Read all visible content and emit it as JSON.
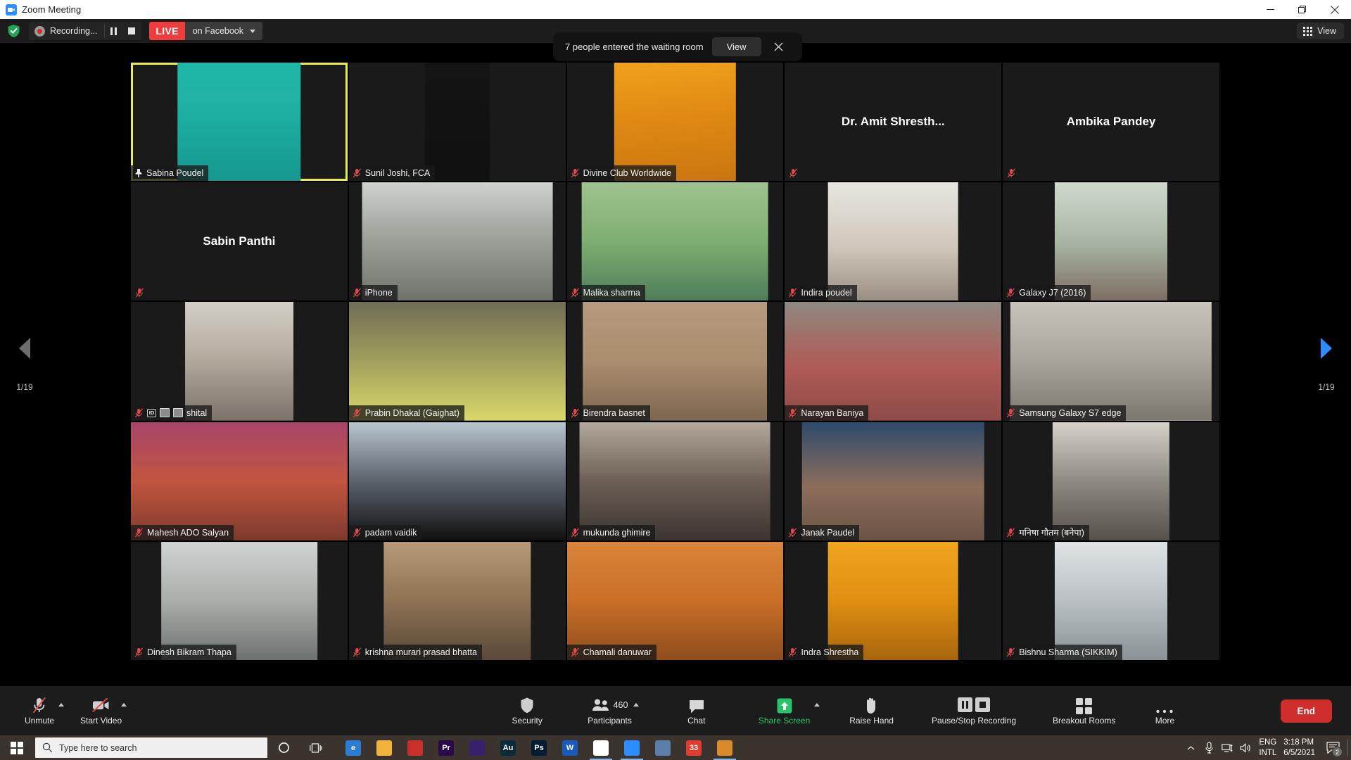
{
  "window": {
    "title": "Zoom Meeting",
    "app_icon": "zoom-camera-icon",
    "minimize_label": "Minimize",
    "maximize_label": "Maximize",
    "close_label": "Close"
  },
  "topbar": {
    "encryption_icon": "green-shield-check-icon",
    "recording_label": "Recording...",
    "pause_recording_label": "Pause recording",
    "stop_recording_label": "Stop recording",
    "live_label": "LIVE",
    "live_target": "on Facebook",
    "view_label": "View",
    "view_icon": "grid-view-icon"
  },
  "toast": {
    "message": "7 people entered the waiting room",
    "action_label": "View",
    "close_label": "Close"
  },
  "gallery": {
    "page_current": "1/19",
    "prev_label": "Previous page",
    "next_label": "Next page",
    "tiles": [
      {
        "name": "Sabina Poudel",
        "muted": false,
        "pinned": true,
        "active_speaker": true,
        "video": true,
        "label_style": "tag",
        "badges": []
      },
      {
        "name": "Sunil Joshi, FCA",
        "muted": true,
        "pinned": false,
        "active_speaker": false,
        "video": true,
        "label_style": "tag",
        "badges": []
      },
      {
        "name": "Divine Club Worldwide",
        "muted": true,
        "pinned": false,
        "active_speaker": false,
        "video": true,
        "label_style": "tag",
        "badges": []
      },
      {
        "name": "Dr. Amit Shresth...",
        "muted": true,
        "pinned": false,
        "active_speaker": false,
        "video": false,
        "label_style": "center",
        "badges": []
      },
      {
        "name": "Ambika Pandey",
        "muted": true,
        "pinned": false,
        "active_speaker": false,
        "video": false,
        "label_style": "center",
        "badges": []
      },
      {
        "name": "Sabin Panthi",
        "muted": true,
        "pinned": false,
        "active_speaker": false,
        "video": false,
        "label_style": "center",
        "badges": []
      },
      {
        "name": "iPhone",
        "muted": true,
        "pinned": false,
        "active_speaker": false,
        "video": true,
        "label_style": "tag",
        "badges": []
      },
      {
        "name": "Malika sharma",
        "muted": true,
        "pinned": false,
        "active_speaker": false,
        "video": true,
        "label_style": "tag",
        "badges": []
      },
      {
        "name": "Indira poudel",
        "muted": true,
        "pinned": false,
        "active_speaker": false,
        "video": true,
        "label_style": "tag",
        "badges": []
      },
      {
        "name": "Galaxy J7 (2016)",
        "muted": true,
        "pinned": false,
        "active_speaker": false,
        "video": true,
        "label_style": "tag",
        "badges": []
      },
      {
        "name": "shital",
        "muted": true,
        "pinned": false,
        "active_speaker": false,
        "video": true,
        "label_style": "tag",
        "badges": [
          "id-badge",
          "mini-chip",
          "mini-chip"
        ]
      },
      {
        "name": "Prabin Dhakal (Gaighat)",
        "muted": true,
        "pinned": false,
        "active_speaker": false,
        "video": true,
        "label_style": "tag",
        "badges": []
      },
      {
        "name": "Birendra basnet",
        "muted": true,
        "pinned": false,
        "active_speaker": false,
        "video": true,
        "label_style": "tag",
        "badges": []
      },
      {
        "name": "Narayan Baniya",
        "muted": true,
        "pinned": false,
        "active_speaker": false,
        "video": true,
        "label_style": "tag",
        "badges": []
      },
      {
        "name": "Samsung Galaxy S7 edge",
        "muted": true,
        "pinned": false,
        "active_speaker": false,
        "video": true,
        "label_style": "tag",
        "badges": []
      },
      {
        "name": "Mahesh ADO Salyan",
        "muted": true,
        "pinned": false,
        "active_speaker": false,
        "video": true,
        "label_style": "tag",
        "badges": []
      },
      {
        "name": "padam vaidik",
        "muted": true,
        "pinned": false,
        "active_speaker": false,
        "video": true,
        "label_style": "tag",
        "badges": []
      },
      {
        "name": "mukunda ghimire",
        "muted": true,
        "pinned": false,
        "active_speaker": false,
        "video": true,
        "label_style": "tag",
        "badges": []
      },
      {
        "name": "Janak Paudel",
        "muted": true,
        "pinned": false,
        "active_speaker": false,
        "video": true,
        "label_style": "tag",
        "badges": []
      },
      {
        "name": "मनिषा गौतम (बनेपा)",
        "muted": true,
        "pinned": false,
        "active_speaker": false,
        "video": true,
        "label_style": "tag",
        "badges": []
      },
      {
        "name": "Dinesh Bikram Thapa",
        "muted": true,
        "pinned": false,
        "active_speaker": false,
        "video": true,
        "label_style": "tag",
        "badges": []
      },
      {
        "name": "krishna murari prasad bhatta",
        "muted": true,
        "pinned": false,
        "active_speaker": false,
        "video": true,
        "label_style": "tag",
        "badges": []
      },
      {
        "name": "Chamali danuwar",
        "muted": true,
        "pinned": false,
        "active_speaker": false,
        "video": true,
        "label_style": "tag",
        "badges": []
      },
      {
        "name": "Indra Shrestha",
        "muted": true,
        "pinned": false,
        "active_speaker": false,
        "video": true,
        "label_style": "tag",
        "badges": []
      },
      {
        "name": "Bishnu Sharma (SIKKIM)",
        "muted": true,
        "pinned": false,
        "active_speaker": false,
        "video": true,
        "label_style": "tag",
        "badges": []
      }
    ]
  },
  "toolbar": {
    "unmute_label": "Unmute",
    "start_video_label": "Start Video",
    "security_label": "Security",
    "participants_label": "Participants",
    "participants_count": "460",
    "chat_label": "Chat",
    "share_screen_label": "Share Screen",
    "raise_hand_label": "Raise Hand",
    "pause_stop_recording_label": "Pause/Stop Recording",
    "breakout_rooms_label": "Breakout Rooms",
    "more_label": "More",
    "end_label": "End"
  },
  "taskbar": {
    "start_label": "Start",
    "search_placeholder": "Type here to search",
    "cortana_label": "Cortana",
    "task_view_label": "Task View",
    "apps": [
      {
        "name": "edge-icon",
        "letter": "e",
        "bg": "#2b7cd3",
        "active": false
      },
      {
        "name": "file-explorer-icon",
        "letter": "",
        "bg": "#f2b33d",
        "active": false
      },
      {
        "name": "kite-icon",
        "letter": "",
        "bg": "#c9302c",
        "active": false
      },
      {
        "name": "premiere-pro-icon",
        "letter": "Pr",
        "bg": "#2a0a4a",
        "active": false
      },
      {
        "name": "adobe-app-icon",
        "letter": "",
        "bg": "#3a1f6e",
        "active": false
      },
      {
        "name": "audition-icon",
        "letter": "Au",
        "bg": "#0b2a3a",
        "active": false
      },
      {
        "name": "photoshop-icon",
        "letter": "Ps",
        "bg": "#021c33",
        "active": false
      },
      {
        "name": "word-icon",
        "letter": "W",
        "bg": "#185abd",
        "active": false
      },
      {
        "name": "chrome-icon",
        "letter": "",
        "bg": "#ffffff",
        "active": true
      },
      {
        "name": "zoom-taskbar-icon",
        "letter": "",
        "bg": "#2d8cff",
        "active": true
      },
      {
        "name": "photos-icon",
        "letter": "",
        "bg": "#5a7fa8",
        "active": false
      },
      {
        "name": "calendar-icon",
        "letter": "33",
        "bg": "#e33b2e",
        "active": false
      },
      {
        "name": "media-player-icon",
        "letter": "",
        "bg": "#d98a2b",
        "active": true
      }
    ],
    "tray": {
      "show_hidden_label": "Show hidden icons",
      "mic_icon": "microphone-icon",
      "network_icon": "network-icon",
      "volume_icon": "speaker-icon",
      "language": "ENG",
      "language_sub": "INTL",
      "time": "3:18 PM",
      "date": "6/5/2021",
      "notification_count": "2"
    }
  },
  "colors": {
    "accent_blue": "#2d8cff",
    "live_red": "#ef3c3c",
    "end_red": "#d02d2d",
    "share_green": "#27c46b",
    "active_border": "#e9ef4a",
    "muted_red": "#e04a4a"
  }
}
